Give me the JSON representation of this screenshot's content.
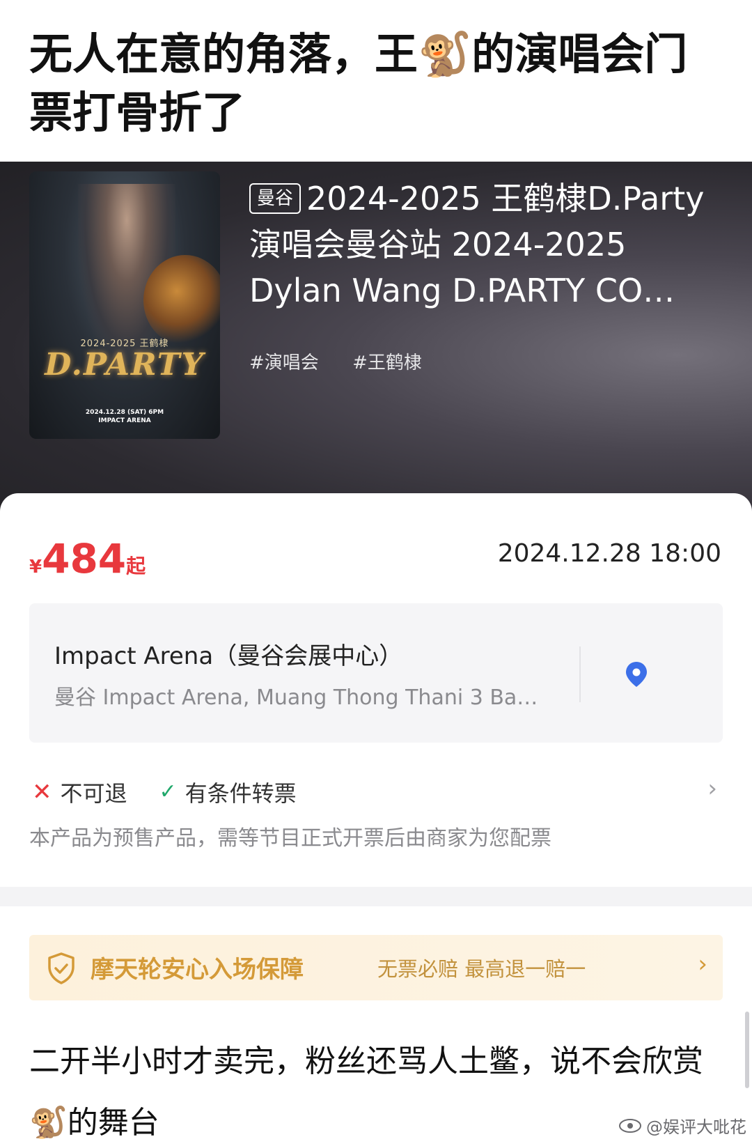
{
  "headline": {
    "part1": "无人在意的角落，王",
    "emoji": "🐒",
    "part2": "的演唱会门票打骨折了"
  },
  "event": {
    "city_tag": "曼谷",
    "title": "2024-2025 王鹤棣D.Party 演唱会曼谷站 2024-2025 Dylan Wang D.PARTY CO…",
    "tags": [
      "#演唱会",
      "#王鹤棣"
    ]
  },
  "poster": {
    "subtitle": "2024-2025 王鹤棣",
    "logo": "D.PARTY",
    "date": "2024.12.28 (SAT) 6PM",
    "venue": "IMPACT ARENA"
  },
  "ticket": {
    "currency": "¥",
    "price": "484",
    "price_suffix": "起",
    "datetime": "2024.12.28 18:00"
  },
  "venue": {
    "name": "Impact Arena（曼谷会展中心）",
    "address": "曼谷 Impact Arena, Muang Thong Thani 3 Ba…",
    "icon": "location-pin-icon"
  },
  "policies": {
    "items": [
      {
        "label": "不可退",
        "icon": "x-icon"
      },
      {
        "label": "有条件转票",
        "icon": "check-icon"
      }
    ],
    "notice": "本产品为预售产品，需等节目正式开票后由商家为您配票"
  },
  "guarantee": {
    "title": "摩天轮安心入场保障",
    "subtitle": "无票必赔 最高退一赔一"
  },
  "caption": {
    "part1": "二开半小时才卖完，粉丝还骂人土鳖，说不会欣赏",
    "emoji": "🐒",
    "part2": "的舞台"
  },
  "watermark": {
    "text": "@娱评大吡花"
  },
  "colors": {
    "price_red": "#e8383d",
    "check_green": "#20a86b",
    "pin_blue": "#3c6fe8",
    "guarantee_gold": "#d49a38"
  }
}
